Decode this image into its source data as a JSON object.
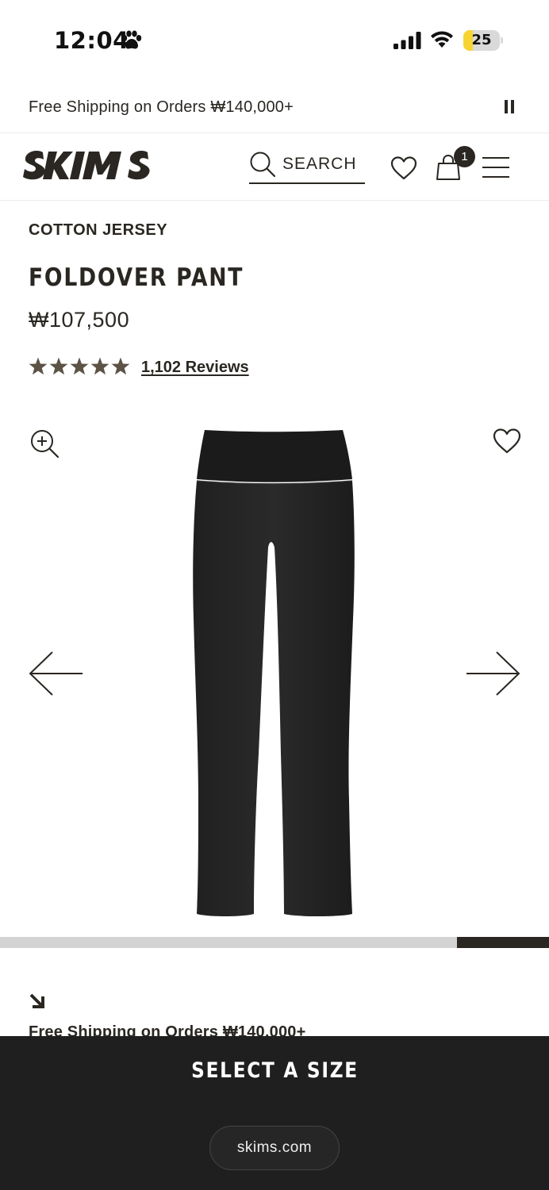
{
  "status_bar": {
    "time": "12:04",
    "battery": "25",
    "battery_level": 0.25
  },
  "promo_bar": {
    "text": "Free Shipping on Orders ₩140,000+"
  },
  "header": {
    "brand": "SKIMS",
    "search_label": "SEARCH",
    "cart_count": "1"
  },
  "product": {
    "collection": "COTTON JERSEY",
    "name": "FOLDOVER PANT",
    "price": "₩107,500",
    "rating": 5,
    "reviews_label": "1,102 Reviews"
  },
  "gallery": {
    "progress": 0.167
  },
  "shipping_notice": "Free Shipping on Orders ₩140,000+",
  "bottom_bar": {
    "cta": "SELECT A SIZE",
    "url": "skims.com"
  },
  "colors": {
    "text": "#2a2722",
    "star": "#5c5245",
    "bottom_bar": "#1f1f1f",
    "battery_fill": "#f7d531"
  }
}
